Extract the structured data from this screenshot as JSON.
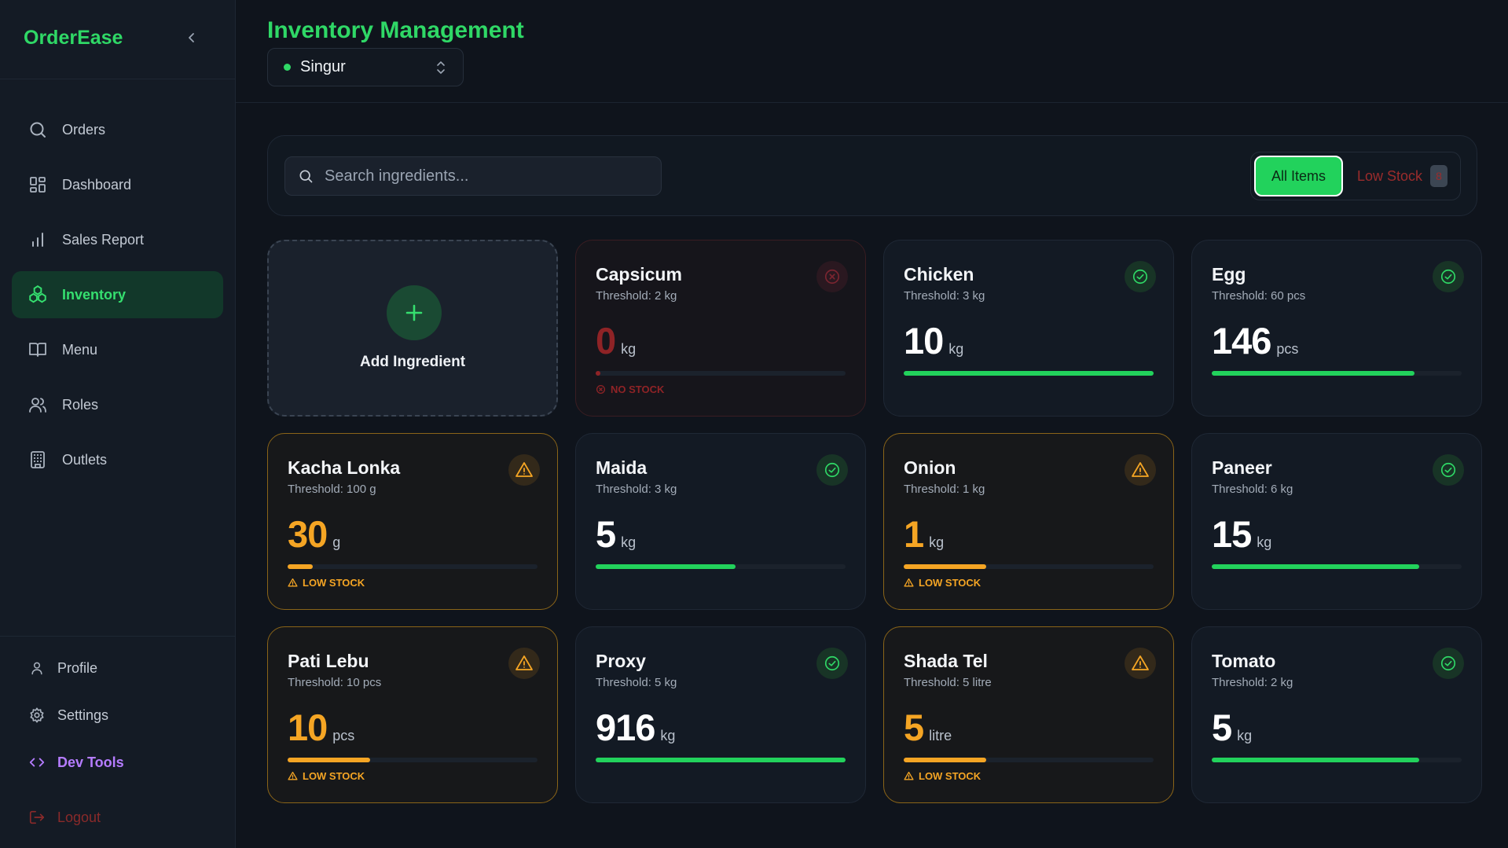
{
  "app": {
    "brand": "OrderEase"
  },
  "sidebar": {
    "items": [
      {
        "label": "Orders",
        "icon": "search-icon"
      },
      {
        "label": "Dashboard",
        "icon": "dashboard-icon"
      },
      {
        "label": "Sales Report",
        "icon": "bar-chart-icon"
      },
      {
        "label": "Inventory",
        "icon": "inventory-icon",
        "active": true
      },
      {
        "label": "Menu",
        "icon": "book-icon"
      },
      {
        "label": "Roles",
        "icon": "users-icon"
      },
      {
        "label": "Outlets",
        "icon": "building-icon"
      }
    ],
    "bottom": {
      "profile": "Profile",
      "settings": "Settings",
      "dev_tools": "Dev Tools",
      "logout": "Logout"
    }
  },
  "header": {
    "title": "Inventory Management",
    "outlet": "Singur"
  },
  "toolbar": {
    "search_placeholder": "Search ingredients...",
    "filter_all": "All Items",
    "filter_low": "Low Stock",
    "low_count": "8"
  },
  "add_card": {
    "label": "Add Ingredient"
  },
  "labels": {
    "low_stock": "LOW STOCK",
    "no_stock": "NO STOCK"
  },
  "ingredients": [
    {
      "name": "Capsicum",
      "threshold": "Threshold: 2 kg",
      "qty": "0",
      "unit": "kg",
      "status": "out",
      "level": 0
    },
    {
      "name": "Chicken",
      "threshold": "Threshold: 3 kg",
      "qty": "10",
      "unit": "kg",
      "status": "ok",
      "level": 1.0
    },
    {
      "name": "Egg",
      "threshold": "Threshold: 60 pcs",
      "qty": "146",
      "unit": "pcs",
      "status": "ok",
      "level": 0.81
    },
    {
      "name": "Kacha Lonka",
      "threshold": "Threshold: 100 g",
      "qty": "30",
      "unit": "g",
      "status": "low",
      "level": 0.1
    },
    {
      "name": "Maida",
      "threshold": "Threshold: 3 kg",
      "qty": "5",
      "unit": "kg",
      "status": "ok",
      "level": 0.56
    },
    {
      "name": "Onion",
      "threshold": "Threshold: 1 kg",
      "qty": "1",
      "unit": "kg",
      "status": "low",
      "level": 0.33
    },
    {
      "name": "Paneer",
      "threshold": "Threshold: 6 kg",
      "qty": "15",
      "unit": "kg",
      "status": "ok",
      "level": 0.83
    },
    {
      "name": "Pati Lebu",
      "threshold": "Threshold: 10 pcs",
      "qty": "10",
      "unit": "pcs",
      "status": "low",
      "level": 0.33
    },
    {
      "name": "Proxy",
      "threshold": "Threshold: 5 kg",
      "qty": "916",
      "unit": "kg",
      "status": "ok",
      "level": 1.0
    },
    {
      "name": "Shada Tel",
      "threshold": "Threshold: 5 litre",
      "qty": "5",
      "unit": "litre",
      "status": "low",
      "level": 0.33
    },
    {
      "name": "Tomato",
      "threshold": "Threshold: 2 kg",
      "qty": "5",
      "unit": "kg",
      "status": "ok",
      "level": 0.83
    }
  ],
  "colors": {
    "accent": "#2fd866",
    "warn": "#f5a524",
    "danger": "#8f2326",
    "dev": "#b57cff"
  }
}
